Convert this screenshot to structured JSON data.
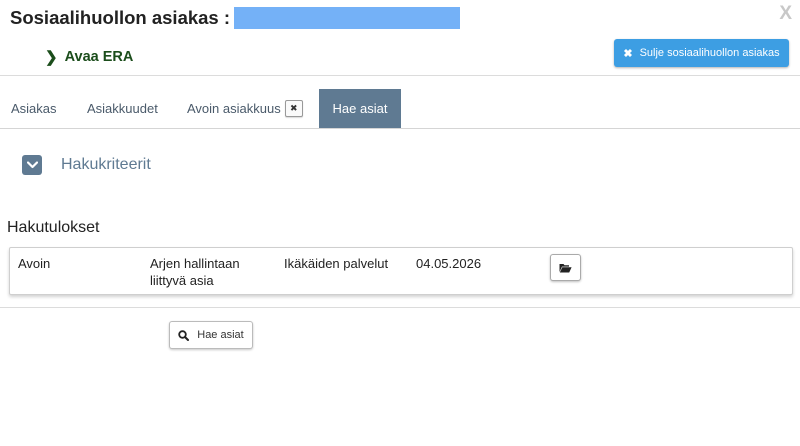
{
  "header": {
    "title": "Sosiaalihuollon asiakas :",
    "close_symbol": "X",
    "era_link_chevron": "❯",
    "era_link_label": "Avaa ERA",
    "close_client_x": "✖",
    "close_client_label": "Sulje sosiaalihuollon asiakas",
    "accent_color": "#3d9ee3"
  },
  "tabs": [
    {
      "label": "Asiakas",
      "active": false
    },
    {
      "label": "Asiakkuudet",
      "active": false
    },
    {
      "label": "Avoin asiakkuus",
      "active": false,
      "closable": true,
      "close_symbol": "✖"
    },
    {
      "label": "Hae asiat",
      "active": true
    }
  ],
  "criteria": {
    "label": "Hakukriteerit",
    "expanded": false
  },
  "results": {
    "title": "Hakutulokset",
    "rows": [
      {
        "status": "Avoin",
        "subject": "Arjen hallintaan liittyvä asia",
        "service": "Ikäkäiden palvelut",
        "date": "04.05.2026",
        "action_icon": "folder-open-icon"
      }
    ]
  },
  "search_button": {
    "label": "Hae asiat",
    "icon": "search-icon"
  }
}
